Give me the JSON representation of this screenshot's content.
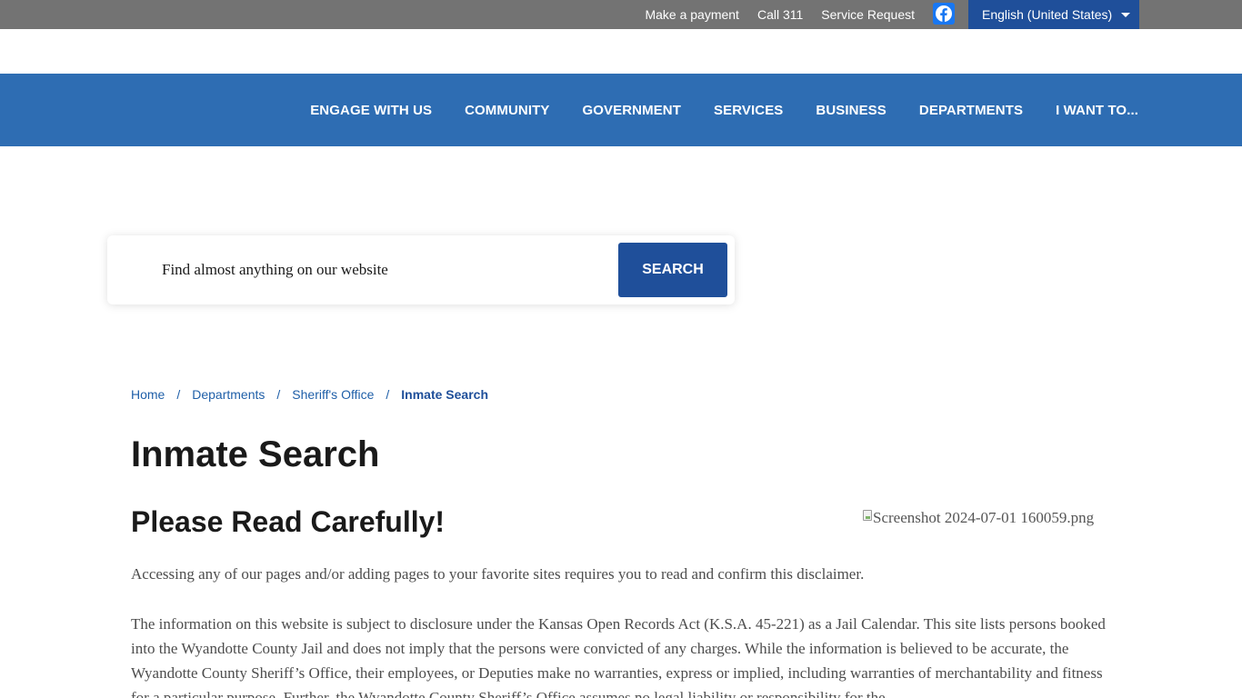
{
  "utility_bar": {
    "links": [
      "Make a payment",
      "Call 311",
      "Service Request"
    ],
    "social": "facebook-icon",
    "language": "English (United States)"
  },
  "nav": {
    "items": [
      "ENGAGE WITH US",
      "COMMUNITY",
      "GOVERNMENT",
      "SERVICES",
      "BUSINESS",
      "DEPARTMENTS",
      "I WANT TO..."
    ]
  },
  "search": {
    "placeholder": "Find almost anything on our website",
    "button_label": "SEARCH"
  },
  "breadcrumb": {
    "items": [
      "Home",
      "Departments",
      "Sheriff's Office"
    ],
    "separator": "/",
    "current": "Inmate Search"
  },
  "page": {
    "title": "Inmate Search",
    "section_heading": "Please Read Carefully!",
    "image_alt": "Screenshot 2024-07-01 160059.png",
    "paragraphs": [
      "Accessing any of our pages and/or adding pages to your favorite sites requires you to read and confirm this disclaimer.",
      "The information on this website is subject to disclosure under the Kansas Open Records Act (K.S.A. 45-221) as a Jail Calendar. This site lists persons booked into the Wyandotte County Jail and does not imply that the persons were convicted of any charges. While the information is believed to be accurate, the Wyandotte County Sheriff’s Office, their employees, or Deputies make no warranties, express or implied, including warranties of merchantability and fitness for a particular purpose. Further, the Wyandotte County Sheriff’s Office assumes no legal liability or responsibility for the"
    ]
  },
  "colors": {
    "utility_bar": "#737373",
    "nav_bar": "#2e6db3",
    "accent_dark_blue": "#1f4f9a",
    "link_blue": "#1f5fa8",
    "facebook_blue": "#1877f2"
  }
}
